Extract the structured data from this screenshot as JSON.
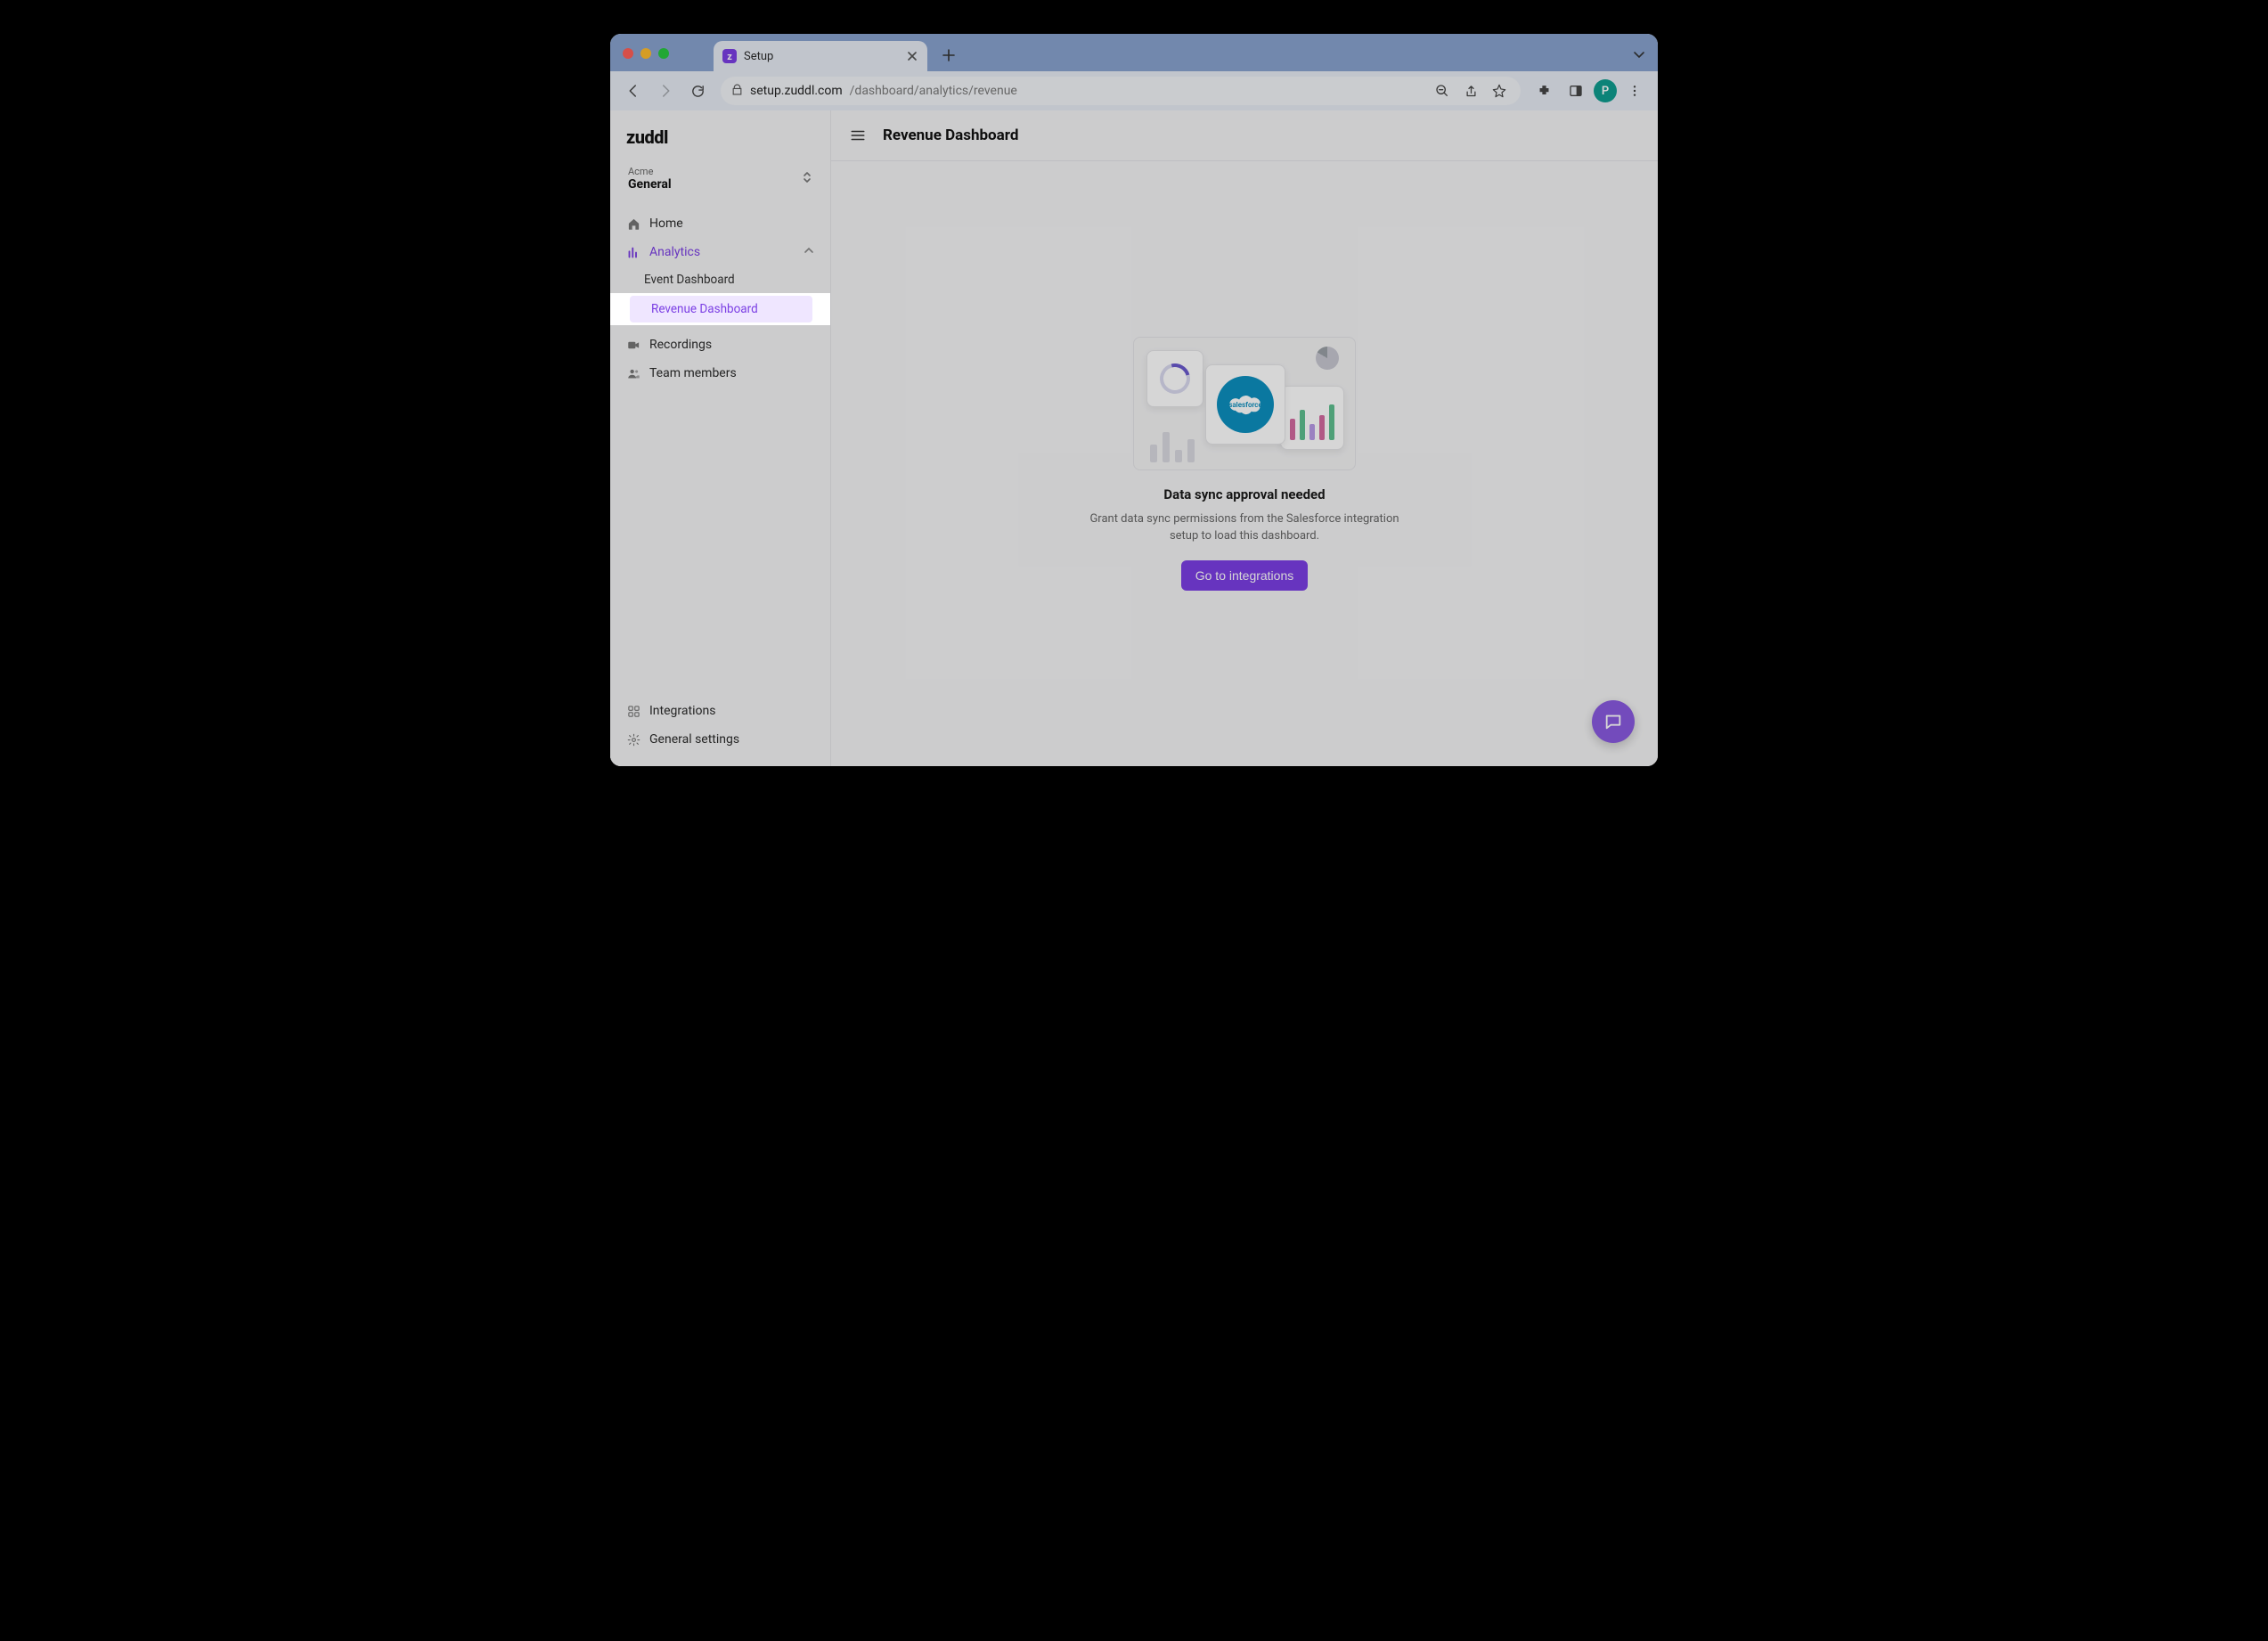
{
  "browser": {
    "tab": {
      "title": "Setup",
      "favicon_letter": "z"
    },
    "url": {
      "host": "setup.zuddl.com",
      "path": "/dashboard/analytics/revenue"
    },
    "avatar_letter": "P"
  },
  "app": {
    "logo_text": "zuddl",
    "workspace": {
      "org": "Acme",
      "name": "General"
    },
    "page_title": "Revenue Dashboard",
    "sidebar": {
      "items": [
        {
          "label": "Home"
        },
        {
          "label": "Analytics"
        },
        {
          "label": "Recordings"
        },
        {
          "label": "Team members"
        }
      ],
      "analytics_sub": [
        {
          "label": "Event Dashboard"
        },
        {
          "label": "Revenue Dashboard"
        }
      ],
      "bottom": [
        {
          "label": "Integrations"
        },
        {
          "label": "General settings"
        }
      ]
    },
    "empty_state": {
      "title": "Data sync approval needed",
      "description": "Grant data sync permissions from the Salesforce integration setup to load this dashboard.",
      "cta": "Go to integrations",
      "illustration_brand": "salesforce"
    }
  },
  "colors": {
    "accent": "#7b3fe4",
    "highlight_bg": "#efe6ff"
  }
}
